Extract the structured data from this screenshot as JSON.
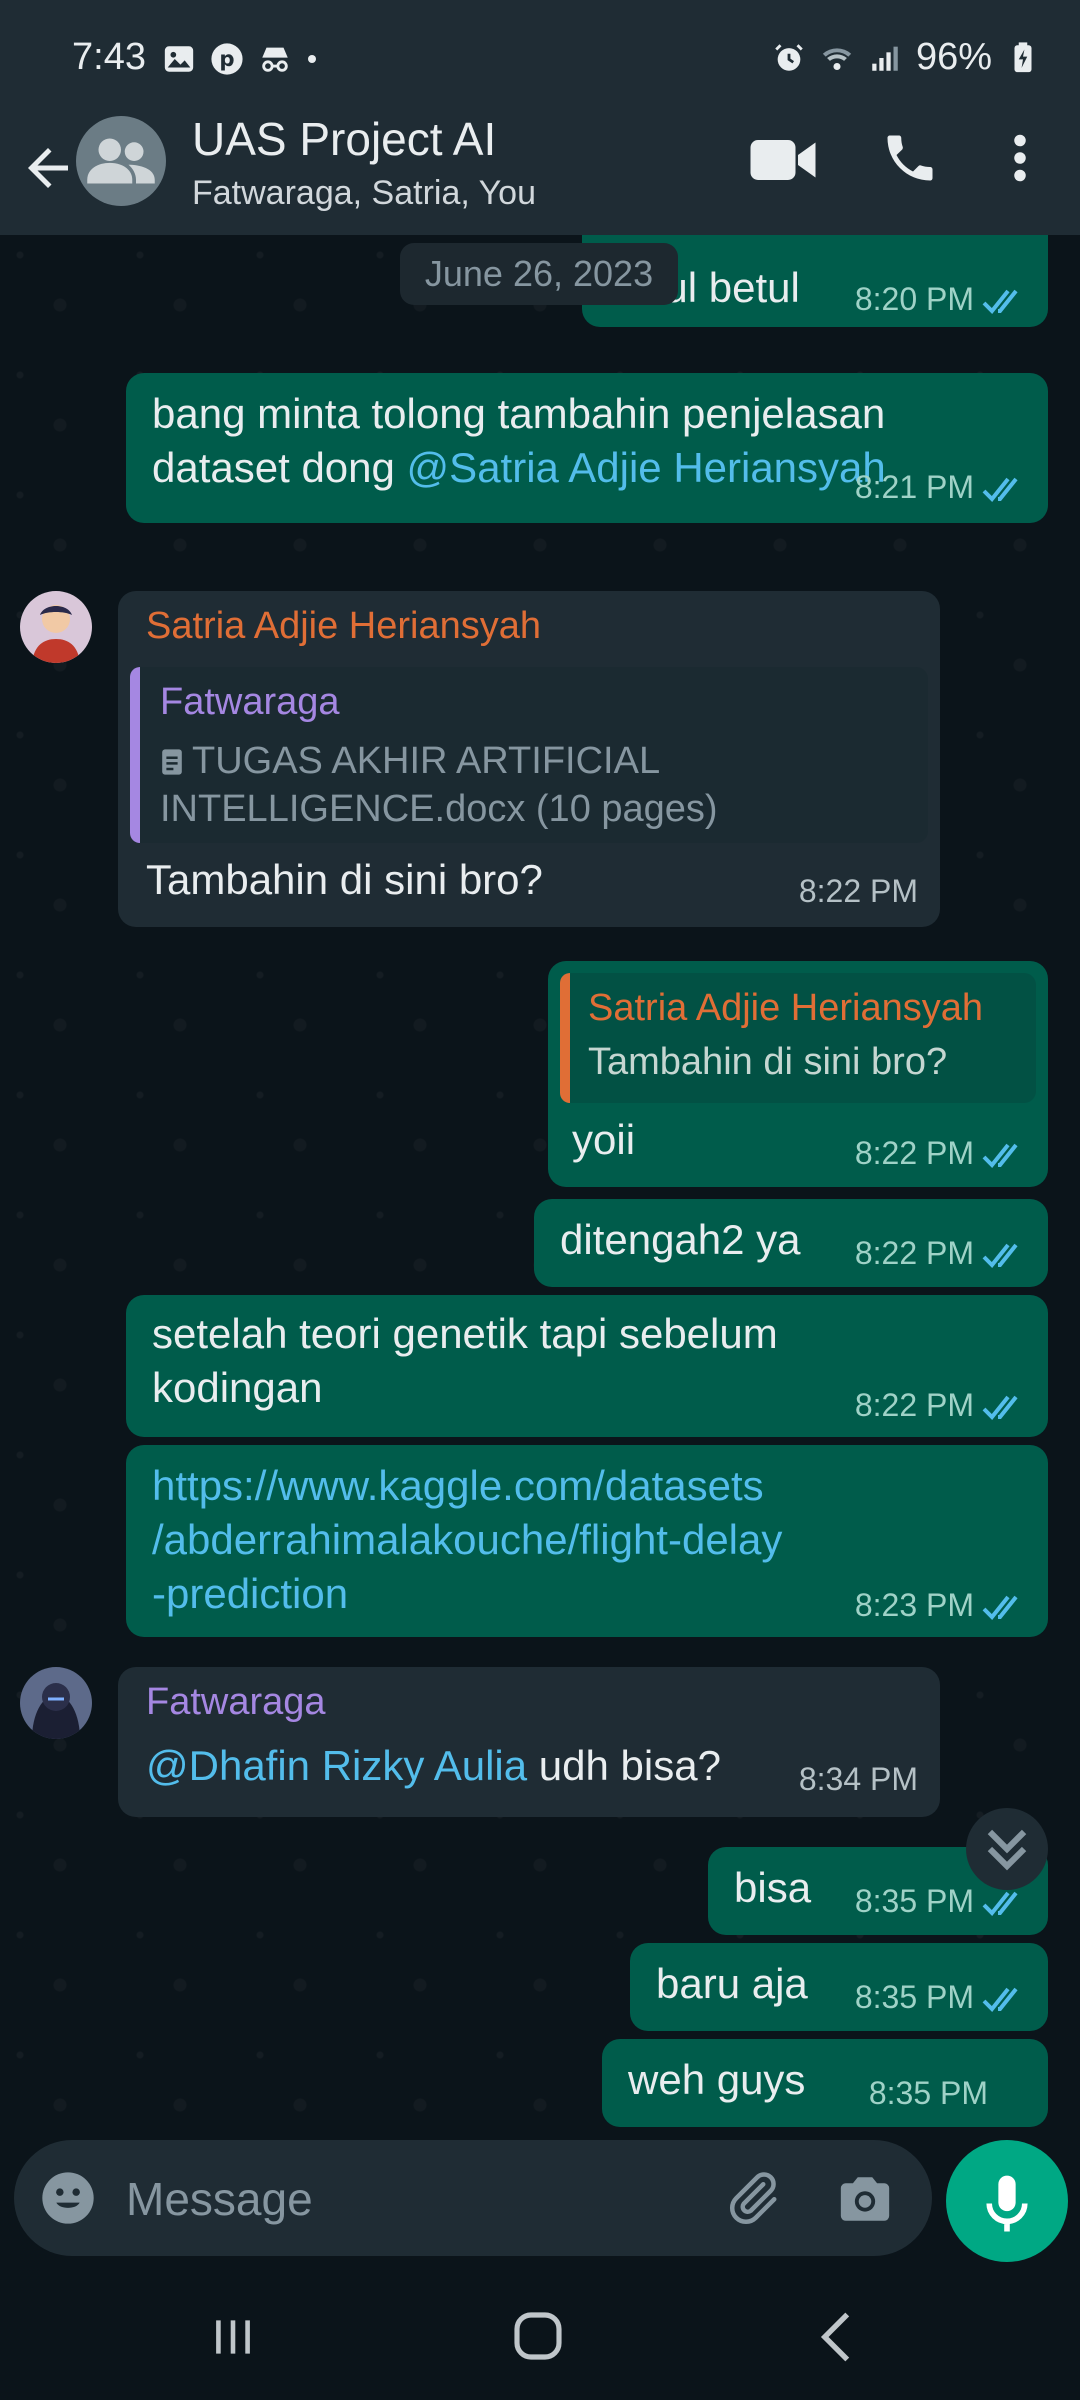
{
  "status_bar": {
    "time": "7:43",
    "battery": "96%"
  },
  "header": {
    "title": "UAS Project AI",
    "subtitle": "Fatwaraga, Satria, You"
  },
  "date_chip": "June 26, 2023",
  "messages": [
    {
      "text": "betul betul",
      "time": "8:20 PM"
    },
    {
      "text_before": "bang minta tolong tambahin penjelasan dataset dong ",
      "mention": "@Satria Adjie Heriansyah",
      "time": "8:21 PM"
    },
    {
      "sender": "Satria Adjie Heriansyah",
      "quote_sender": "Fatwaraga",
      "quote_line1": "TUGAS AKHIR ARTIFICIAL",
      "quote_line2": "INTELLIGENCE.docx (10 pages)",
      "text": "Tambahin di sini bro?",
      "time": "8:22 PM"
    },
    {
      "quote_sender": "Satria Adjie Heriansyah",
      "quote_text": "Tambahin di sini bro?",
      "text": "yoii",
      "time": "8:22 PM"
    },
    {
      "text": "ditengah2 ya",
      "time": "8:22 PM"
    },
    {
      "line1": "setelah teori genetik tapi sebelum",
      "line2": "kodingan",
      "time": "8:22 PM"
    },
    {
      "line1": "https://www.kaggle.com/datasets",
      "line2": "/abderrahimalakouche/flight-delay",
      "line3": "-prediction",
      "time": "8:23 PM"
    },
    {
      "sender": "Fatwaraga",
      "mention": "@Dhafin Rizky Aulia",
      "text": " udh bisa?",
      "time": "8:34 PM"
    },
    {
      "text": "bisa",
      "time": "8:35 PM"
    },
    {
      "text": "baru aja",
      "time": "8:35 PM"
    },
    {
      "text": "weh guys",
      "time": "8:35 PM"
    }
  ],
  "composer": {
    "placeholder": "Message"
  },
  "colors": {
    "outgoing": "#005c4b",
    "incoming": "#1f2c34",
    "accent": "#00a884",
    "mention": "#53bdeb"
  }
}
